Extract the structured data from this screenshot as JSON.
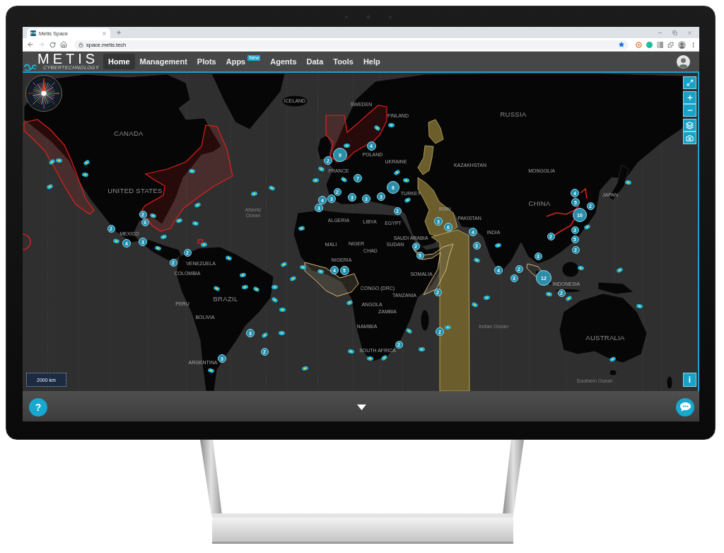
{
  "browser": {
    "tabs": [
      {
        "title": "Metis Space",
        "selected": true
      }
    ],
    "history": [
      {
        "kind": "back",
        "disabled": false
      },
      {
        "kind": "forward",
        "disabled": true
      }
    ],
    "url": "space.metis.tech",
    "bookmarked": true
  },
  "app": {
    "logo": {
      "name": "METIS",
      "tagline": "CYBERTECHNOLOGY"
    },
    "nav": [
      {
        "label": "Home",
        "selected": true
      },
      {
        "label": "Management",
        "selected": false
      },
      {
        "label": "Plots",
        "selected": false
      },
      {
        "label": "Apps",
        "selected": false,
        "badge": "New"
      },
      {
        "label": "Agents",
        "selected": false
      },
      {
        "label": "Data",
        "selected": false
      },
      {
        "label": "Tools",
        "selected": false
      },
      {
        "label": "Help",
        "selected": false
      }
    ]
  },
  "map": {
    "labels": [
      {
        "text": "CANADA"
      },
      {
        "text": "UNITED STATES"
      },
      {
        "text": "RUSSIA"
      },
      {
        "text": "CHINA"
      },
      {
        "text": "BRAZIL"
      },
      {
        "text": "AUSTRALIA"
      },
      {
        "text": "ICELAND"
      },
      {
        "text": "KAZAKHSTAN"
      },
      {
        "text": "MONGOLIA"
      },
      {
        "text": "INDIA"
      },
      {
        "text": "IRAN"
      },
      {
        "text": "SAUDI ARABIA"
      },
      {
        "text": "ALGERIA"
      },
      {
        "text": "LIBYA"
      },
      {
        "text": "EGYPT"
      },
      {
        "text": "TURKEY"
      },
      {
        "text": "POLAND"
      },
      {
        "text": "UKRAINE"
      },
      {
        "text": "FRANCE"
      },
      {
        "text": "MEXICO"
      },
      {
        "text": "VENEZUELA"
      },
      {
        "text": "COLOMBIA"
      },
      {
        "text": "PERU"
      },
      {
        "text": "BOLIVIA"
      },
      {
        "text": "ARGENTINA"
      },
      {
        "text": "CHAD"
      },
      {
        "text": "SUDAN"
      },
      {
        "text": "SOMALIA"
      },
      {
        "text": "TANZANIA"
      },
      {
        "text": "ANGOLA"
      },
      {
        "text": "ZAMBIA"
      },
      {
        "text": "NAMIBIA"
      },
      {
        "text": "SOUTH AFRICA"
      },
      {
        "text": "INDONESIA"
      },
      {
        "text": "PAKISTAN"
      },
      {
        "text": "JAPAN"
      },
      {
        "text": "SWEDEN"
      },
      {
        "text": "FINLAND"
      },
      {
        "text": "CONGO (DRC)"
      },
      {
        "text": "MALI"
      },
      {
        "text": "NIGER"
      },
      {
        "text": "NIGERIA"
      },
      {
        "text": "Atlantic Ocean"
      },
      {
        "text": "Indian Ocean"
      },
      {
        "text": "Southern Ocean"
      }
    ],
    "clusters": [
      {
        "count": "9"
      },
      {
        "count": "2"
      },
      {
        "count": "4"
      },
      {
        "count": "7"
      },
      {
        "count": "4"
      },
      {
        "count": "3"
      },
      {
        "count": "2"
      },
      {
        "count": "3"
      },
      {
        "count": "3"
      },
      {
        "count": "3"
      },
      {
        "count": "3"
      },
      {
        "count": "6"
      },
      {
        "count": "2"
      },
      {
        "count": "3"
      },
      {
        "count": "6"
      },
      {
        "count": "4"
      },
      {
        "count": "4"
      },
      {
        "count": "5"
      },
      {
        "count": "10"
      },
      {
        "count": "2"
      },
      {
        "count": "3"
      },
      {
        "count": "5"
      },
      {
        "count": "2"
      },
      {
        "count": "2"
      },
      {
        "count": "5"
      },
      {
        "count": "3"
      },
      {
        "count": "4"
      },
      {
        "count": "2"
      },
      {
        "count": "3"
      },
      {
        "count": "12"
      },
      {
        "count": "3"
      },
      {
        "count": "2"
      },
      {
        "count": "2"
      },
      {
        "count": "2"
      },
      {
        "count": "2"
      },
      {
        "count": "2"
      },
      {
        "count": "4"
      },
      {
        "count": "3"
      },
      {
        "count": "2"
      },
      {
        "count": "2"
      },
      {
        "count": "3"
      },
      {
        "count": "2"
      },
      {
        "count": "3"
      },
      {
        "count": "4"
      },
      {
        "count": "5"
      },
      {
        "count": "2"
      },
      {
        "count": "2"
      },
      {
        "count": "3"
      }
    ],
    "scale": "2000 km",
    "info_button": "i"
  },
  "bottom_bar": {
    "help_button": "?"
  }
}
